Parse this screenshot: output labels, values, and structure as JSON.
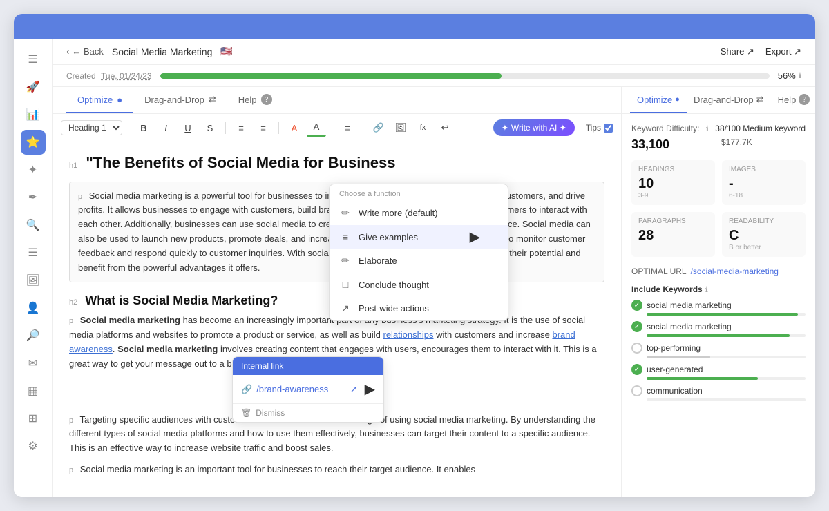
{
  "topbar": {
    "color": "#5b7fe0"
  },
  "header": {
    "back_label": "← Back",
    "page_title": "Social Media Marketing",
    "flag": "🇺🇸",
    "share_label": "Share ↗",
    "export_label": "Export ↗"
  },
  "progress": {
    "created_label": "Created",
    "created_date": "Tue, 01/24/23",
    "percent": 56,
    "percent_label": "56%"
  },
  "tabs": {
    "optimize": "Optimize",
    "drag_drop": "Drag-and-Drop",
    "help": "Help"
  },
  "toolbar": {
    "heading_select": "Heading 1",
    "bold": "B",
    "italic": "I",
    "underline": "U",
    "strike": "S",
    "list_ol": "≡",
    "list_ul": "≡",
    "color": "A",
    "bg_color": "A",
    "align": "≡",
    "link": "🔗",
    "image": "🖼",
    "code": "fx",
    "undo": "↩",
    "write_ai": "Write with AI ✦",
    "tips": "Tips"
  },
  "ai_dropdown": {
    "header": "Choose a function",
    "items": [
      {
        "id": "write-more",
        "icon": "✏",
        "label": "Write more (default)"
      },
      {
        "id": "give-examples",
        "icon": "≡",
        "label": "Give examples",
        "selected": true
      },
      {
        "id": "elaborate",
        "icon": "✏",
        "label": "Elaborate"
      },
      {
        "id": "conclude-thought",
        "icon": "□",
        "label": "Conclude thought"
      },
      {
        "id": "post-wide-actions",
        "icon": "↗",
        "label": "Post-wide actions"
      }
    ]
  },
  "article": {
    "h1_tag": "h1",
    "h1_text": "\"The Benefits of Social Media for Business",
    "body_text": "Social media marketing is a powerful tool for businesses to increase their reach, build relationships with customers, and drive profits. It allows businesses to engage with customers, build brand loyalty, and create a community for customers to interact with each other. Additionally, businesses can use social media to create targeted campaigns and track performance. Social media can also be used to launch new products, promote deals, and increase visibility. Finally, it provides an easy way to monitor customer feedback and respond quickly to customer inquiries. With social media marketing, businesses can maximize their potential and benefit from the powerful advantages it offers.",
    "h2_tag": "h2",
    "h2_text": "What is Social Media Marketing?",
    "p2_tag": "p",
    "p2_text": "Social media marketing has become an increasingly important part of any business's marketing strategy. It is the use of social media platforms and websites to promote a product or service, as well as build relationships with customers and increase brand awareness. Social media marketing involves creating content that engages with users, encourages them to interact with it. This is a great way to get your message out to a broader audience.",
    "p3_tag": "p",
    "p3_text": "Targeting specific audiences with customized content is another advantage of using social media marketing. By understanding the different types of social media platforms and how to use them effectively, businesses can target their content to a specific audience. This is an effective way to increase website traffic and boost sales.",
    "p4_tag": "p",
    "p4_text": "Social media marketing is an important tool for businesses to reach their target audience. It enables"
  },
  "internal_link_popup": {
    "header": "Internal link",
    "link_text": "/brand-awareness",
    "dismiss_label": "Dismiss"
  },
  "right_panel": {
    "tabs": [
      "Optimize",
      "Drag-and-Drop",
      "Help"
    ],
    "keyword_difficulty_label": "Keyword Difficulty:",
    "keyword_difficulty_value": "38/100 Medium keyword",
    "search_volume": "33,100",
    "cost": "$177.7K",
    "headings": {
      "label": "HEADINGS",
      "value": "10",
      "range": "3-9"
    },
    "images": {
      "label": "IMAGES",
      "value": "-",
      "range": "6-18"
    },
    "paragraphs": {
      "label": "PARAGRAPHS",
      "value": "28",
      "range": ""
    },
    "readability": {
      "label": "READABILITY",
      "value": "C",
      "range": "B or better"
    },
    "optimal_url_label": "OPTIMAL URL",
    "optimal_url": "/social-media-marketing",
    "include_keywords_label": "Include Keywords",
    "keywords": [
      {
        "id": "kw1",
        "text": "social media marketing",
        "checked": true,
        "bar_percent": 95
      },
      {
        "id": "kw2",
        "text": "social media marketing",
        "checked": true,
        "bar_percent": 90
      },
      {
        "id": "kw3",
        "text": "top-performing",
        "checked": false,
        "bar_percent": 40
      },
      {
        "id": "kw4",
        "text": "user-generated",
        "checked": true,
        "bar_percent": 70
      },
      {
        "id": "kw5",
        "text": "communication",
        "checked": false,
        "bar_percent": 0
      }
    ]
  },
  "sidebar": {
    "icons": [
      {
        "id": "menu",
        "symbol": "☰"
      },
      {
        "id": "rocket",
        "symbol": "🚀"
      },
      {
        "id": "chart",
        "symbol": "📊"
      },
      {
        "id": "star-active",
        "symbol": "⭐",
        "active": true
      },
      {
        "id": "magic",
        "symbol": "✦"
      },
      {
        "id": "pen",
        "symbol": "✒"
      },
      {
        "id": "search",
        "symbol": "🔍"
      },
      {
        "id": "list",
        "symbol": "☰"
      },
      {
        "id": "image2",
        "symbol": "🖼"
      },
      {
        "id": "user",
        "symbol": "👤"
      },
      {
        "id": "search2",
        "symbol": "🔎"
      },
      {
        "id": "mail",
        "symbol": "✉"
      },
      {
        "id": "grid",
        "symbol": "▦"
      },
      {
        "id": "table",
        "symbol": "⊞"
      },
      {
        "id": "settings",
        "symbol": "⚙"
      }
    ]
  }
}
